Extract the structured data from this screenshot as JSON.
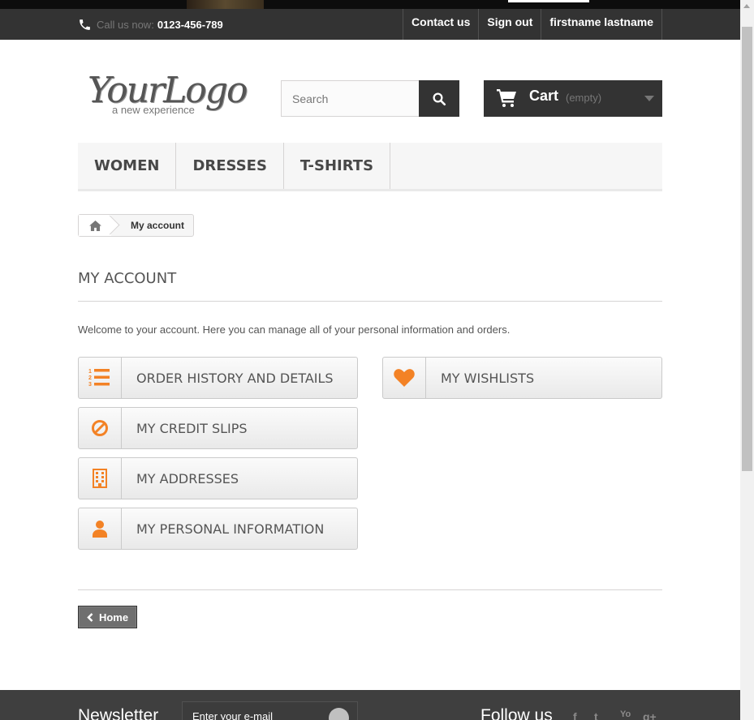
{
  "header": {
    "call_label": "Call us now:",
    "phone": "0123-456-789",
    "links": [
      "Contact us",
      "Sign out",
      "firstname lastname"
    ]
  },
  "logo": {
    "main": "YourLogo",
    "tagline": "a new experience"
  },
  "search": {
    "placeholder": "Search"
  },
  "cart": {
    "label": "Cart",
    "status": "(empty)"
  },
  "menu": [
    "WOMEN",
    "DRESSES",
    "T-SHIRTS"
  ],
  "breadcrumb": {
    "current": "My account"
  },
  "page": {
    "title": "MY ACCOUNT",
    "welcome": "Welcome to your account. Here you can manage all of your personal information and orders.",
    "accent": "#f38225",
    "items": [
      {
        "label": "ORDER HISTORY AND DETAILS",
        "icon": "list-ol-icon"
      },
      {
        "label": "MY CREDIT SLIPS",
        "icon": "ban-icon"
      },
      {
        "label": "MY ADDRESSES",
        "icon": "building-icon"
      },
      {
        "label": "MY PERSONAL INFORMATION",
        "icon": "user-icon"
      },
      {
        "label": "MY WISHLISTS",
        "icon": "heart-icon"
      }
    ],
    "home_button": "Home"
  },
  "footer": {
    "newsletter_title": "Newsletter",
    "newsletter_placeholder": "Enter your e-mail",
    "follow_title": "Follow us"
  }
}
